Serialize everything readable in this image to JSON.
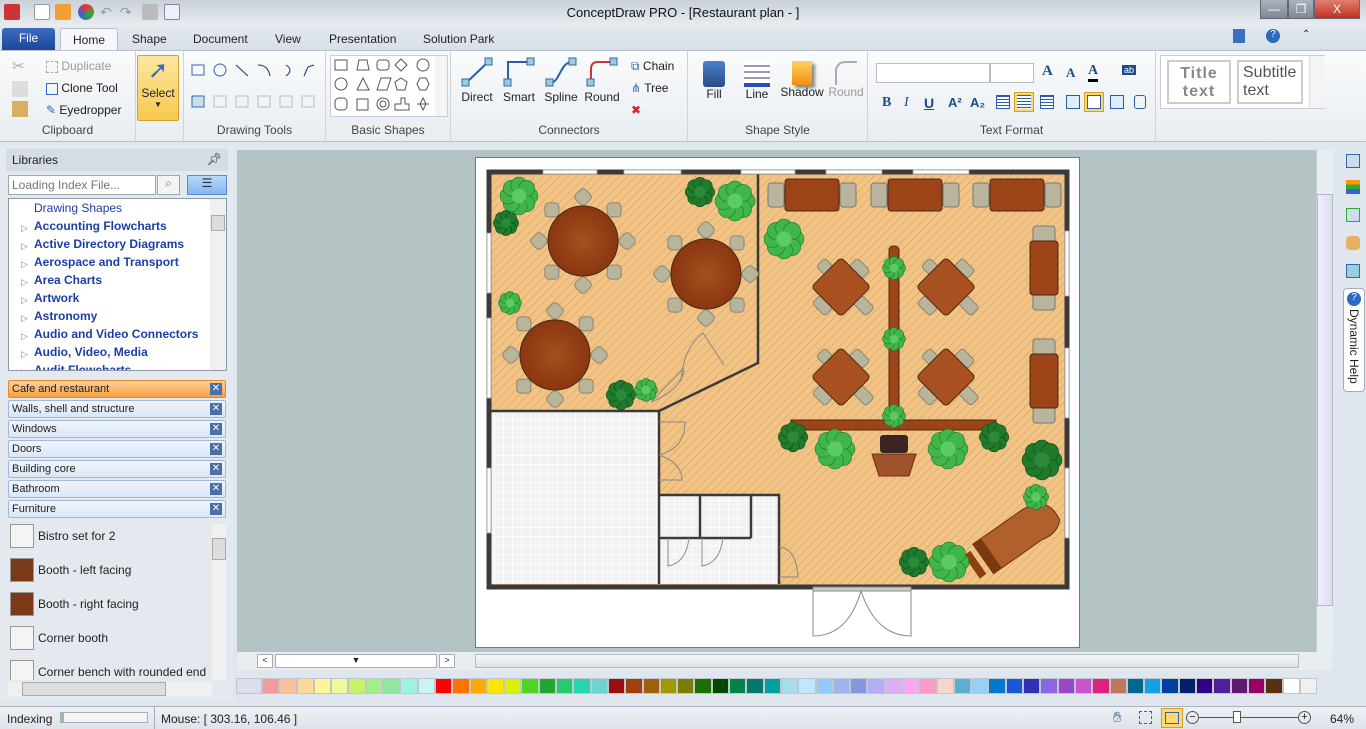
{
  "window": {
    "title": "ConceptDraw PRO - [Restaurant plan -  ]",
    "minimize": "—",
    "restore": "❐",
    "close": "X"
  },
  "ribbon_tabs": {
    "file": "File",
    "tabs": [
      "Home",
      "Shape",
      "Document",
      "View",
      "Presentation",
      "Solution Park"
    ],
    "active": "Home"
  },
  "clipboard": {
    "duplicate": "Duplicate",
    "clone_tool": "Clone Tool",
    "eyedropper": "Eyedropper",
    "label": "Clipboard"
  },
  "select": {
    "label": "Select"
  },
  "drawing_tools": {
    "label": "Drawing Tools"
  },
  "basic_shapes": {
    "label": "Basic Shapes"
  },
  "connectors": {
    "direct": "Direct",
    "smart": "Smart",
    "spline": "Spline",
    "round": "Round",
    "chain": "Chain",
    "tree": "Tree",
    "label": "Connectors"
  },
  "shape_style": {
    "fill": "Fill",
    "line": "Line",
    "shadow": "Shadow",
    "round": "Round",
    "label": "Shape Style"
  },
  "text_format": {
    "label": "Text Format",
    "font": "",
    "size": "",
    "bold": "B",
    "italic": "I",
    "underline": "U",
    "superscript": "A²",
    "subscript": "A₂",
    "grow": "A",
    "shrink": "A",
    "color": "A",
    "highlight": "ab"
  },
  "styles": {
    "title": "Title text",
    "subtitle": "Subtitle text"
  },
  "libraries": {
    "header": "Libraries",
    "search_placeholder": "Loading Index File...",
    "tree": [
      "Drawing Shapes",
      "Accounting Flowcharts",
      "Active Directory Diagrams",
      "Aerospace and Transport",
      "Area Charts",
      "Artwork",
      "Astronomy",
      "Audio and Video Connectors",
      "Audio, Video, Media",
      "Audit Flowcharts"
    ],
    "open": [
      "Cafe and restaurant",
      "Walls, shell and structure",
      "Windows",
      "Doors",
      "Building core",
      "Bathroom",
      "Furniture"
    ],
    "active_library": "Cafe and restaurant",
    "shapes": [
      "Bistro set for 2",
      "Booth - left facing",
      "Booth - right facing",
      "Corner booth",
      "Corner bench with rounded end"
    ]
  },
  "right_panel": {
    "dynamic_help": "Dynamic Help"
  },
  "palette": [
    "#f59a9a",
    "#fbc09a",
    "#fdd99a",
    "#fef59a",
    "#f1fa9a",
    "#c5f46a",
    "#a4ee88",
    "#8ee8a0",
    "#9cf4e0",
    "#c9f6f4",
    "#ff0000",
    "#ff7300",
    "#ffaa00",
    "#ffe600",
    "#d9f200",
    "#4fd41f",
    "#1fa830",
    "#29c873",
    "#25d6b0",
    "#6ed4d0",
    "#990f10",
    "#a0400a",
    "#a0600a",
    "#a09a00",
    "#787f00",
    "#1a7000",
    "#004a00",
    "#00844a",
    "#00786a",
    "#00a0a0",
    "#a6dcec",
    "#c2e6ff",
    "#93c9ff",
    "#a0b4ec",
    "#8496e0",
    "#b4aef6",
    "#dbaef6",
    "#fca6f4",
    "#fc9ac9",
    "#f9d6cc",
    "#5bb0d0",
    "#95d0f8",
    "#0078d0",
    "#1c56d8",
    "#3030b8",
    "#8a66e6",
    "#9a46c8",
    "#c854d0",
    "#e0207c",
    "#c07858",
    "#006890",
    "#14a0e8",
    "#0040a0",
    "#00206a",
    "#300088",
    "#50209a",
    "#601a70",
    "#980068",
    "#583010",
    "#ffffff",
    "#f0f0f0"
  ],
  "status": {
    "indexing": "Indexing",
    "indexing_progress": 0.03,
    "mouse": "Mouse: [ 303.16, 106.46 ]",
    "zoom": "64%",
    "zoom_level": 64
  },
  "colors": {
    "floor": "#f1c486",
    "wood": "#9c4418",
    "plant_light": "#3fb54a",
    "plant_dark": "#1f7a2c",
    "wall": "#3a3a3a",
    "canvas": "#b3c3c3"
  }
}
